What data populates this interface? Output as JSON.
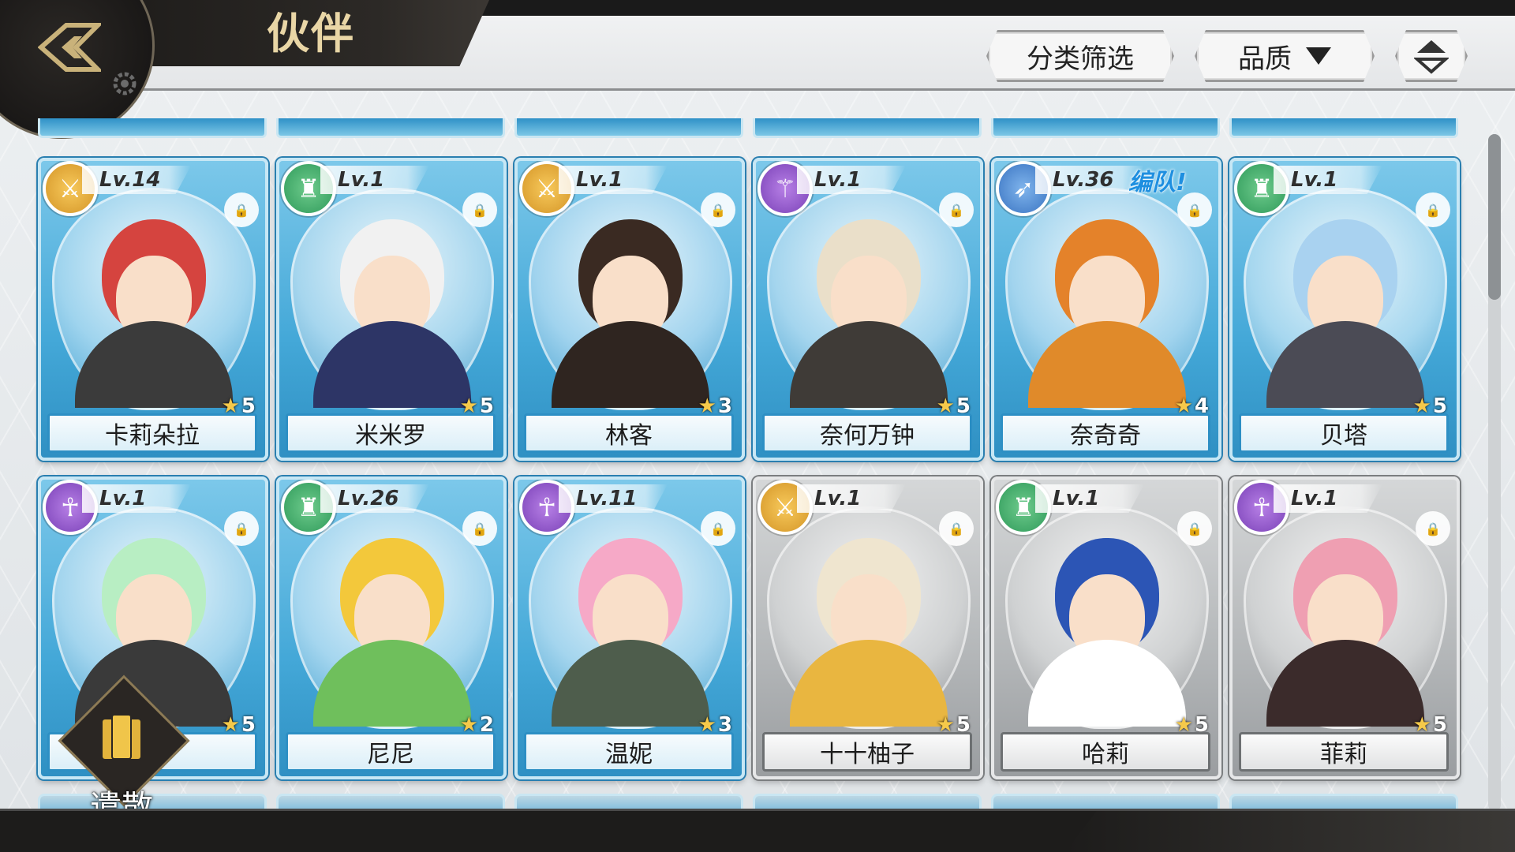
{
  "header": {
    "title": "伙伴",
    "filter_label": "分类筛选",
    "quality_label": "品质"
  },
  "actions": {
    "dismiss_label": "遣散"
  },
  "cards": [
    {
      "name": "卡莉朵拉",
      "level": "Lv.14",
      "stars": "5",
      "element": "gold",
      "team": ""
    },
    {
      "name": "米米罗",
      "level": "Lv.1",
      "stars": "5",
      "element": "green",
      "team": ""
    },
    {
      "name": "林客",
      "level": "Lv.1",
      "stars": "3",
      "element": "gold",
      "team": ""
    },
    {
      "name": "奈何万钟",
      "level": "Lv.1",
      "stars": "5",
      "element": "purple",
      "team": ""
    },
    {
      "name": "奈奇奇",
      "level": "Lv.36",
      "stars": "4",
      "element": "blue",
      "team": "编队!"
    },
    {
      "name": "贝塔",
      "level": "Lv.1",
      "stars": "5",
      "element": "green",
      "team": ""
    },
    {
      "name": "",
      "level": "Lv.1",
      "stars": "5",
      "element": "purple",
      "team": ""
    },
    {
      "name": "尼尼",
      "level": "Lv.26",
      "stars": "2",
      "element": "green",
      "team": ""
    },
    {
      "name": "温妮",
      "level": "Lv.11",
      "stars": "3",
      "element": "purple",
      "team": ""
    },
    {
      "name": "十十柚子",
      "level": "Lv.1",
      "stars": "5",
      "element": "gold",
      "team": ""
    },
    {
      "name": "哈莉",
      "level": "Lv.1",
      "stars": "5",
      "element": "green",
      "team": ""
    },
    {
      "name": "菲莉",
      "level": "Lv.1",
      "stars": "5",
      "element": "purple",
      "team": ""
    }
  ]
}
